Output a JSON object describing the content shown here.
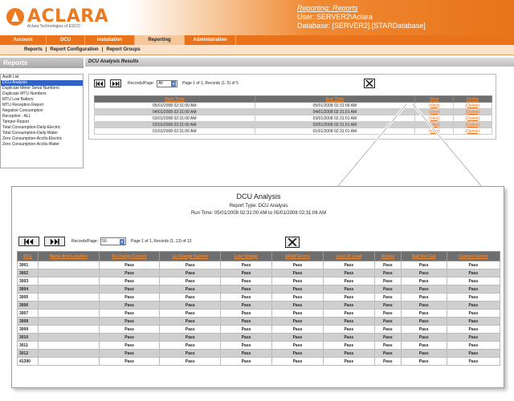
{
  "header": {
    "logo_text": "ACLARA",
    "logo_sub": "Aclara Technologies of ESCO",
    "title": "Reporting: Reports",
    "user": "User: SERVER2\\Aclara",
    "database": "Database: [SERVER2].[STARDatabase]",
    "brand_color": "#ee7a1f"
  },
  "nav": {
    "tabs": [
      {
        "label": "Account"
      },
      {
        "label": "DCU"
      },
      {
        "label": "Installation"
      },
      {
        "label": "Reporting"
      },
      {
        "label": "Administration"
      }
    ],
    "active_index": 3
  },
  "subnav": {
    "items": [
      "Reports",
      "Report Configuration",
      "Report Groups"
    ],
    "separator": "|"
  },
  "left_panel": {
    "title": "Reports",
    "items": [
      "Audit List",
      "DCU Analysis",
      "Duplicate Meter Serial Numbers",
      "Duplicate MTU Numbers",
      "MTU Low Battery",
      "MTU Reception Report",
      "Negative Consumption",
      "Reception - ALL",
      "Tamper Report",
      "Total Consumption-Daily-Electric",
      "Total Consumption-Daily-Water",
      "Zero Consumption-Acctls-Electric",
      "Zero Consumption-Acctls-Water"
    ],
    "selected_index": 1
  },
  "results": {
    "title": "DCU Analysis Results",
    "pager": {
      "records_label": "Records/Page:",
      "records_value": "All",
      "info": "Page 1 of 1, Records (1..5) of 5"
    },
    "columns": [
      "Start Time",
      "End Time",
      "View",
      "Delete"
    ],
    "rows": [
      {
        "start": "05/01/2008 02:31:00 AM",
        "end": "05/01/2008 02:31:06 AM",
        "view": "(View)",
        "delete": "(Delete)"
      },
      {
        "start": "04/01/2008 02:31:00 AM",
        "end": "04/01/2008 02:31:01 AM",
        "view": "(View)",
        "delete": "(Delete)"
      },
      {
        "start": "03/01/2008 02:31:00 AM",
        "end": "03/01/2008 02:31:01 AM",
        "view": "(View)",
        "delete": "(Delete)"
      },
      {
        "start": "02/01/2008 02:31:00 AM",
        "end": "02/01/2008 02:31:01 AM",
        "view": "(View)",
        "delete": "(Delete)"
      },
      {
        "start": "01/01/2008 02:31:00 AM",
        "end": "01/01/2008 02:31:01 AM",
        "view": "(View)",
        "delete": "(Delete)"
      }
    ]
  },
  "analysis": {
    "title": "DCU Analysis",
    "report_type": "Report Type: DCU Analysis",
    "run_time": "Run Time: 05/01/2008 02:31:00 AM to 05/01/2008 02:31:06 AM",
    "pager": {
      "records_label": "Records/Page:",
      "records_value": "50",
      "info": "Page 1 of 1, Records (1..13) of 13"
    },
    "columns": [
      "DCU",
      "Name And Location",
      "Hi Charge Current",
      "Lo Charge Current",
      "Low Voltage",
      "SRAM Errors",
      "Loss Of Load",
      "Resets",
      "Bad Ret Call",
      "Connect Errors"
    ],
    "rows": [
      {
        "dcu": "3001",
        "location": "",
        "values": [
          "Pass",
          "Pass",
          "Pass",
          "Pass",
          "Pass",
          "Pass",
          "Pass",
          "Pass"
        ]
      },
      {
        "dcu": "3002",
        "location": "",
        "values": [
          "Pass",
          "Pass",
          "Pass",
          "Pass",
          "Pass",
          "Pass",
          "Pass",
          "Pass"
        ]
      },
      {
        "dcu": "3003",
        "location": "",
        "values": [
          "Pass",
          "Pass",
          "Pass",
          "Pass",
          "Pass",
          "Pass",
          "Pass",
          "Pass"
        ]
      },
      {
        "dcu": "3004",
        "location": "",
        "values": [
          "Pass",
          "Pass",
          "Pass",
          "Pass",
          "Pass",
          "Pass",
          "Pass",
          "Pass"
        ]
      },
      {
        "dcu": "3005",
        "location": "",
        "values": [
          "Pass",
          "Pass",
          "Pass",
          "Pass",
          "Pass",
          "Pass",
          "Pass",
          "Pass"
        ]
      },
      {
        "dcu": "3006",
        "location": "",
        "values": [
          "Pass",
          "Pass",
          "Pass",
          "Pass",
          "Pass",
          "Pass",
          "Pass",
          "Pass"
        ]
      },
      {
        "dcu": "3007",
        "location": "",
        "values": [
          "Pass",
          "Pass",
          "Pass",
          "Pass",
          "Pass",
          "Pass",
          "Pass",
          "Pass"
        ]
      },
      {
        "dcu": "3008",
        "location": "",
        "values": [
          "Pass",
          "Pass",
          "Pass",
          "Pass",
          "Pass",
          "Pass",
          "Pass",
          "Pass"
        ]
      },
      {
        "dcu": "3009",
        "location": "",
        "values": [
          "Pass",
          "Pass",
          "Pass",
          "Pass",
          "Pass",
          "Pass",
          "Pass",
          "Pass"
        ]
      },
      {
        "dcu": "3010",
        "location": "",
        "values": [
          "Pass",
          "Pass",
          "Pass",
          "Pass",
          "Pass",
          "Pass",
          "Pass",
          "Pass"
        ]
      },
      {
        "dcu": "3011",
        "location": "",
        "values": [
          "Pass",
          "Pass",
          "Pass",
          "Pass",
          "Pass",
          "Pass",
          "Pass",
          "Pass"
        ]
      },
      {
        "dcu": "3012",
        "location": "",
        "values": [
          "Pass",
          "Pass",
          "Pass",
          "Pass",
          "Pass",
          "Pass",
          "Pass",
          "Pass"
        ]
      },
      {
        "dcu": "41390",
        "location": "",
        "values": [
          "Pass",
          "Pass",
          "Pass",
          "Pass",
          "Pass",
          "Pass",
          "Pass",
          "Pass"
        ]
      }
    ]
  },
  "icons": {
    "first_page": "first-page-icon",
    "last_page": "last-page-icon",
    "close": "close-icon",
    "dropdown": "chevron-down-icon"
  }
}
